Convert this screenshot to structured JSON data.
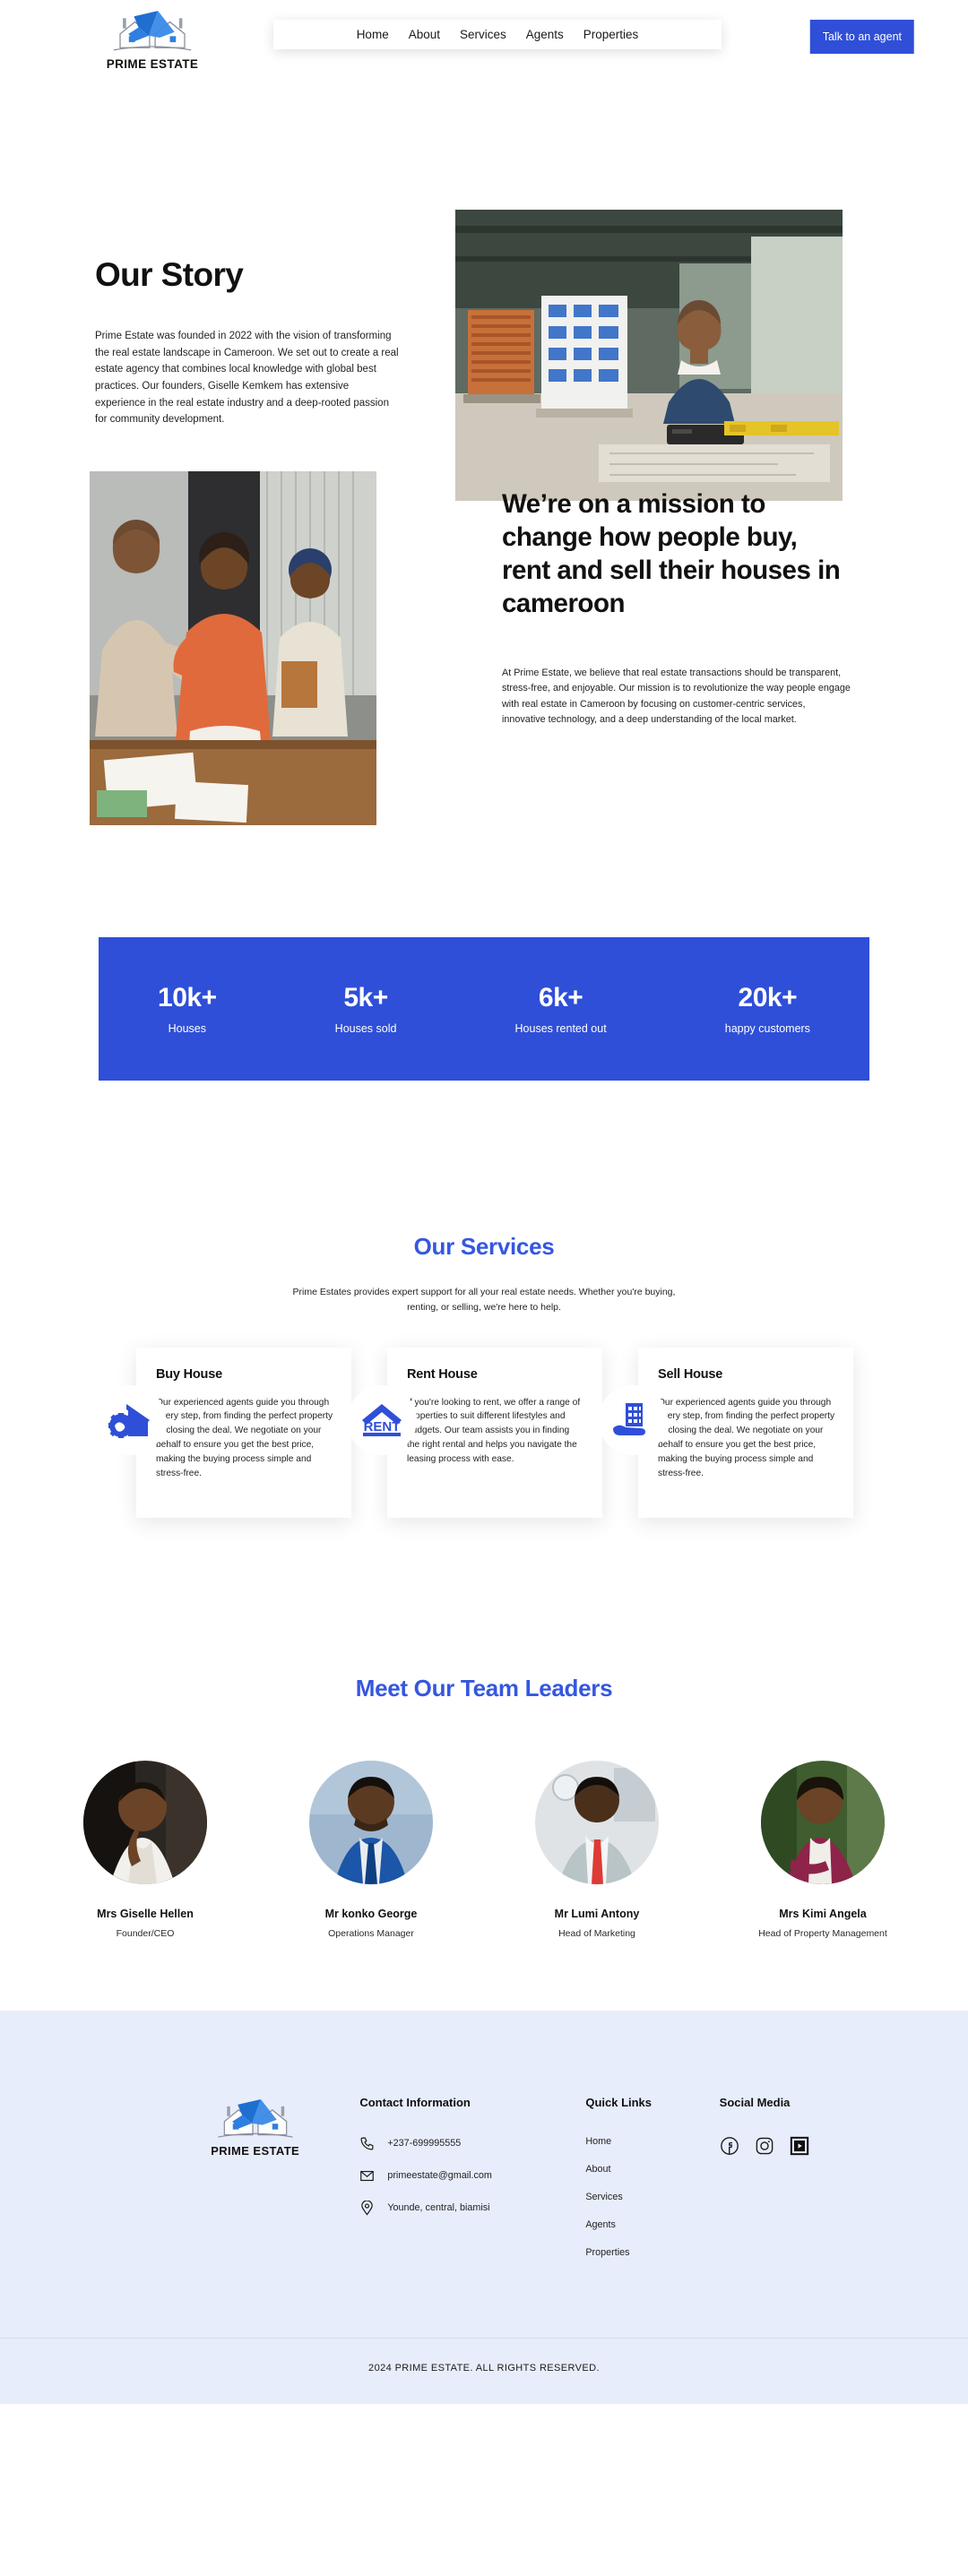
{
  "brand": {
    "name": "PRIME ESTATE",
    "accent": "#2f4fd8",
    "heading_accent": "#3557e0"
  },
  "header": {
    "nav": [
      {
        "label": "Home"
      },
      {
        "label": "About"
      },
      {
        "label": "Services"
      },
      {
        "label": "Agents"
      },
      {
        "label": "Properties"
      }
    ],
    "cta_label": "Talk to an agent"
  },
  "story": {
    "title": "Our Story",
    "body": "Prime Estate was founded in 2022 with the vision of transforming the real estate landscape in Cameroon. We set out to create a real estate agency that combines local knowledge with global best practices. Our founders, Giselle Kemkem has extensive experience in the real estate industry and a deep-rooted passion for community development."
  },
  "mission": {
    "title": "We’re on a mission to change how people buy, rent and sell their houses in cameroon",
    "body": "At Prime Estate, we believe that real estate transactions should be transparent, stress-free, and enjoyable. Our mission is to revolutionize the way people engage with real estate in Cameroon by focusing on customer-centric services, innovative technology, and a deep understanding of the local market."
  },
  "stats": [
    {
      "value": "10k+",
      "label": "Houses"
    },
    {
      "value": "5k+",
      "label": "Houses sold"
    },
    {
      "value": "6k+",
      "label": "Houses rented out"
    },
    {
      "value": "20k+",
      "label": "happy customers"
    }
  ],
  "services": {
    "title": "Our Services",
    "subtitle": "Prime Estates provides expert support for all your real estate needs. Whether you're buying, renting, or selling, we're here to help.",
    "cards": [
      {
        "icon": "house-handshake-icon",
        "title": "Buy House",
        "text": "Our experienced agents guide you through every step, from finding the perfect property to closing the deal. We negotiate on your behalf to ensure you get the best price, making the buying process simple and stress-free."
      },
      {
        "icon": "rent-sign-icon",
        "title": "Rent House",
        "text": "If you're looking to rent, we offer a range of properties to suit different lifestyles and budgets. Our team assists you in finding the right rental and helps you navigate the leasing process with ease."
      },
      {
        "icon": "building-in-hand-icon",
        "title": "Sell House",
        "text": "Our experienced agents guide you through every step, from finding the perfect property to closing the deal. We negotiate on your behalf to ensure you get the best price, making the buying process simple and stress-free."
      }
    ]
  },
  "team": {
    "title": "Meet Our Team Leaders",
    "members": [
      {
        "name": "Mrs Giselle Hellen",
        "role": "Founder/CEO"
      },
      {
        "name": "Mr konko George",
        "role": "Operations Manager"
      },
      {
        "name": "Mr Lumi Antony",
        "role": "Head of Marketing"
      },
      {
        "name": "Mrs Kimi Angela",
        "role": "Head of Property Management"
      }
    ]
  },
  "footer": {
    "contact": {
      "heading": "Contact Information",
      "phone": "+237-699995555",
      "email": "primeestate@gmail.com",
      "address": "Younde, central, biamisi"
    },
    "quick_links": {
      "heading": "Quick Links",
      "items": [
        {
          "label": "Home"
        },
        {
          "label": "About"
        },
        {
          "label": "Services"
        },
        {
          "label": "Agents"
        },
        {
          "label": "Properties"
        }
      ]
    },
    "social": {
      "heading": "Social Media",
      "items": [
        {
          "name": "facebook-icon"
        },
        {
          "name": "instagram-icon"
        },
        {
          "name": "youtube-icon"
        }
      ]
    },
    "copyright": "2024 PRIME ESTATE. ALL RIGHTS RESERVED."
  }
}
